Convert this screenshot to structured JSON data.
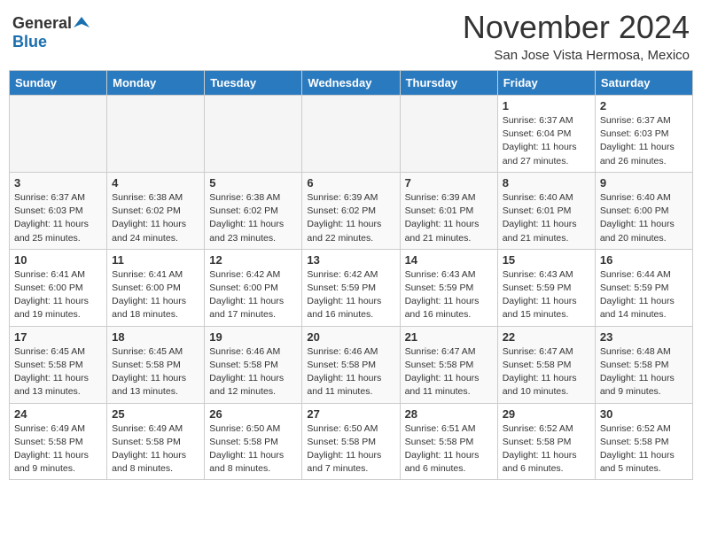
{
  "header": {
    "logo_general": "General",
    "logo_blue": "Blue",
    "month": "November 2024",
    "location": "San Jose Vista Hermosa, Mexico"
  },
  "weekdays": [
    "Sunday",
    "Monday",
    "Tuesday",
    "Wednesday",
    "Thursday",
    "Friday",
    "Saturday"
  ],
  "weeks": [
    [
      {
        "day": "",
        "info": ""
      },
      {
        "day": "",
        "info": ""
      },
      {
        "day": "",
        "info": ""
      },
      {
        "day": "",
        "info": ""
      },
      {
        "day": "",
        "info": ""
      },
      {
        "day": "1",
        "info": "Sunrise: 6:37 AM\nSunset: 6:04 PM\nDaylight: 11 hours and 27 minutes."
      },
      {
        "day": "2",
        "info": "Sunrise: 6:37 AM\nSunset: 6:03 PM\nDaylight: 11 hours and 26 minutes."
      }
    ],
    [
      {
        "day": "3",
        "info": "Sunrise: 6:37 AM\nSunset: 6:03 PM\nDaylight: 11 hours and 25 minutes."
      },
      {
        "day": "4",
        "info": "Sunrise: 6:38 AM\nSunset: 6:02 PM\nDaylight: 11 hours and 24 minutes."
      },
      {
        "day": "5",
        "info": "Sunrise: 6:38 AM\nSunset: 6:02 PM\nDaylight: 11 hours and 23 minutes."
      },
      {
        "day": "6",
        "info": "Sunrise: 6:39 AM\nSunset: 6:02 PM\nDaylight: 11 hours and 22 minutes."
      },
      {
        "day": "7",
        "info": "Sunrise: 6:39 AM\nSunset: 6:01 PM\nDaylight: 11 hours and 21 minutes."
      },
      {
        "day": "8",
        "info": "Sunrise: 6:40 AM\nSunset: 6:01 PM\nDaylight: 11 hours and 21 minutes."
      },
      {
        "day": "9",
        "info": "Sunrise: 6:40 AM\nSunset: 6:00 PM\nDaylight: 11 hours and 20 minutes."
      }
    ],
    [
      {
        "day": "10",
        "info": "Sunrise: 6:41 AM\nSunset: 6:00 PM\nDaylight: 11 hours and 19 minutes."
      },
      {
        "day": "11",
        "info": "Sunrise: 6:41 AM\nSunset: 6:00 PM\nDaylight: 11 hours and 18 minutes."
      },
      {
        "day": "12",
        "info": "Sunrise: 6:42 AM\nSunset: 6:00 PM\nDaylight: 11 hours and 17 minutes."
      },
      {
        "day": "13",
        "info": "Sunrise: 6:42 AM\nSunset: 5:59 PM\nDaylight: 11 hours and 16 minutes."
      },
      {
        "day": "14",
        "info": "Sunrise: 6:43 AM\nSunset: 5:59 PM\nDaylight: 11 hours and 16 minutes."
      },
      {
        "day": "15",
        "info": "Sunrise: 6:43 AM\nSunset: 5:59 PM\nDaylight: 11 hours and 15 minutes."
      },
      {
        "day": "16",
        "info": "Sunrise: 6:44 AM\nSunset: 5:59 PM\nDaylight: 11 hours and 14 minutes."
      }
    ],
    [
      {
        "day": "17",
        "info": "Sunrise: 6:45 AM\nSunset: 5:58 PM\nDaylight: 11 hours and 13 minutes."
      },
      {
        "day": "18",
        "info": "Sunrise: 6:45 AM\nSunset: 5:58 PM\nDaylight: 11 hours and 13 minutes."
      },
      {
        "day": "19",
        "info": "Sunrise: 6:46 AM\nSunset: 5:58 PM\nDaylight: 11 hours and 12 minutes."
      },
      {
        "day": "20",
        "info": "Sunrise: 6:46 AM\nSunset: 5:58 PM\nDaylight: 11 hours and 11 minutes."
      },
      {
        "day": "21",
        "info": "Sunrise: 6:47 AM\nSunset: 5:58 PM\nDaylight: 11 hours and 11 minutes."
      },
      {
        "day": "22",
        "info": "Sunrise: 6:47 AM\nSunset: 5:58 PM\nDaylight: 11 hours and 10 minutes."
      },
      {
        "day": "23",
        "info": "Sunrise: 6:48 AM\nSunset: 5:58 PM\nDaylight: 11 hours and 9 minutes."
      }
    ],
    [
      {
        "day": "24",
        "info": "Sunrise: 6:49 AM\nSunset: 5:58 PM\nDaylight: 11 hours and 9 minutes."
      },
      {
        "day": "25",
        "info": "Sunrise: 6:49 AM\nSunset: 5:58 PM\nDaylight: 11 hours and 8 minutes."
      },
      {
        "day": "26",
        "info": "Sunrise: 6:50 AM\nSunset: 5:58 PM\nDaylight: 11 hours and 8 minutes."
      },
      {
        "day": "27",
        "info": "Sunrise: 6:50 AM\nSunset: 5:58 PM\nDaylight: 11 hours and 7 minutes."
      },
      {
        "day": "28",
        "info": "Sunrise: 6:51 AM\nSunset: 5:58 PM\nDaylight: 11 hours and 6 minutes."
      },
      {
        "day": "29",
        "info": "Sunrise: 6:52 AM\nSunset: 5:58 PM\nDaylight: 11 hours and 6 minutes."
      },
      {
        "day": "30",
        "info": "Sunrise: 6:52 AM\nSunset: 5:58 PM\nDaylight: 11 hours and 5 minutes."
      }
    ]
  ]
}
